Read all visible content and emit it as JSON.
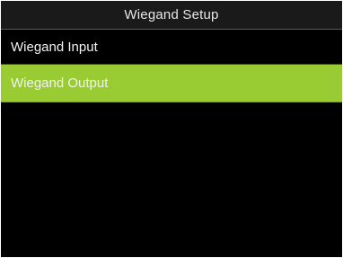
{
  "screen": {
    "title": "Wiegand Setup"
  },
  "menu": {
    "items": [
      {
        "label": "Wiegand Input",
        "selected": false
      },
      {
        "label": "Wiegand Output",
        "selected": true
      }
    ]
  },
  "colors": {
    "background": "#000000",
    "title_bar": "#1a1a1a",
    "selected_item": "#99cc33",
    "text": "#f2f2f2"
  }
}
